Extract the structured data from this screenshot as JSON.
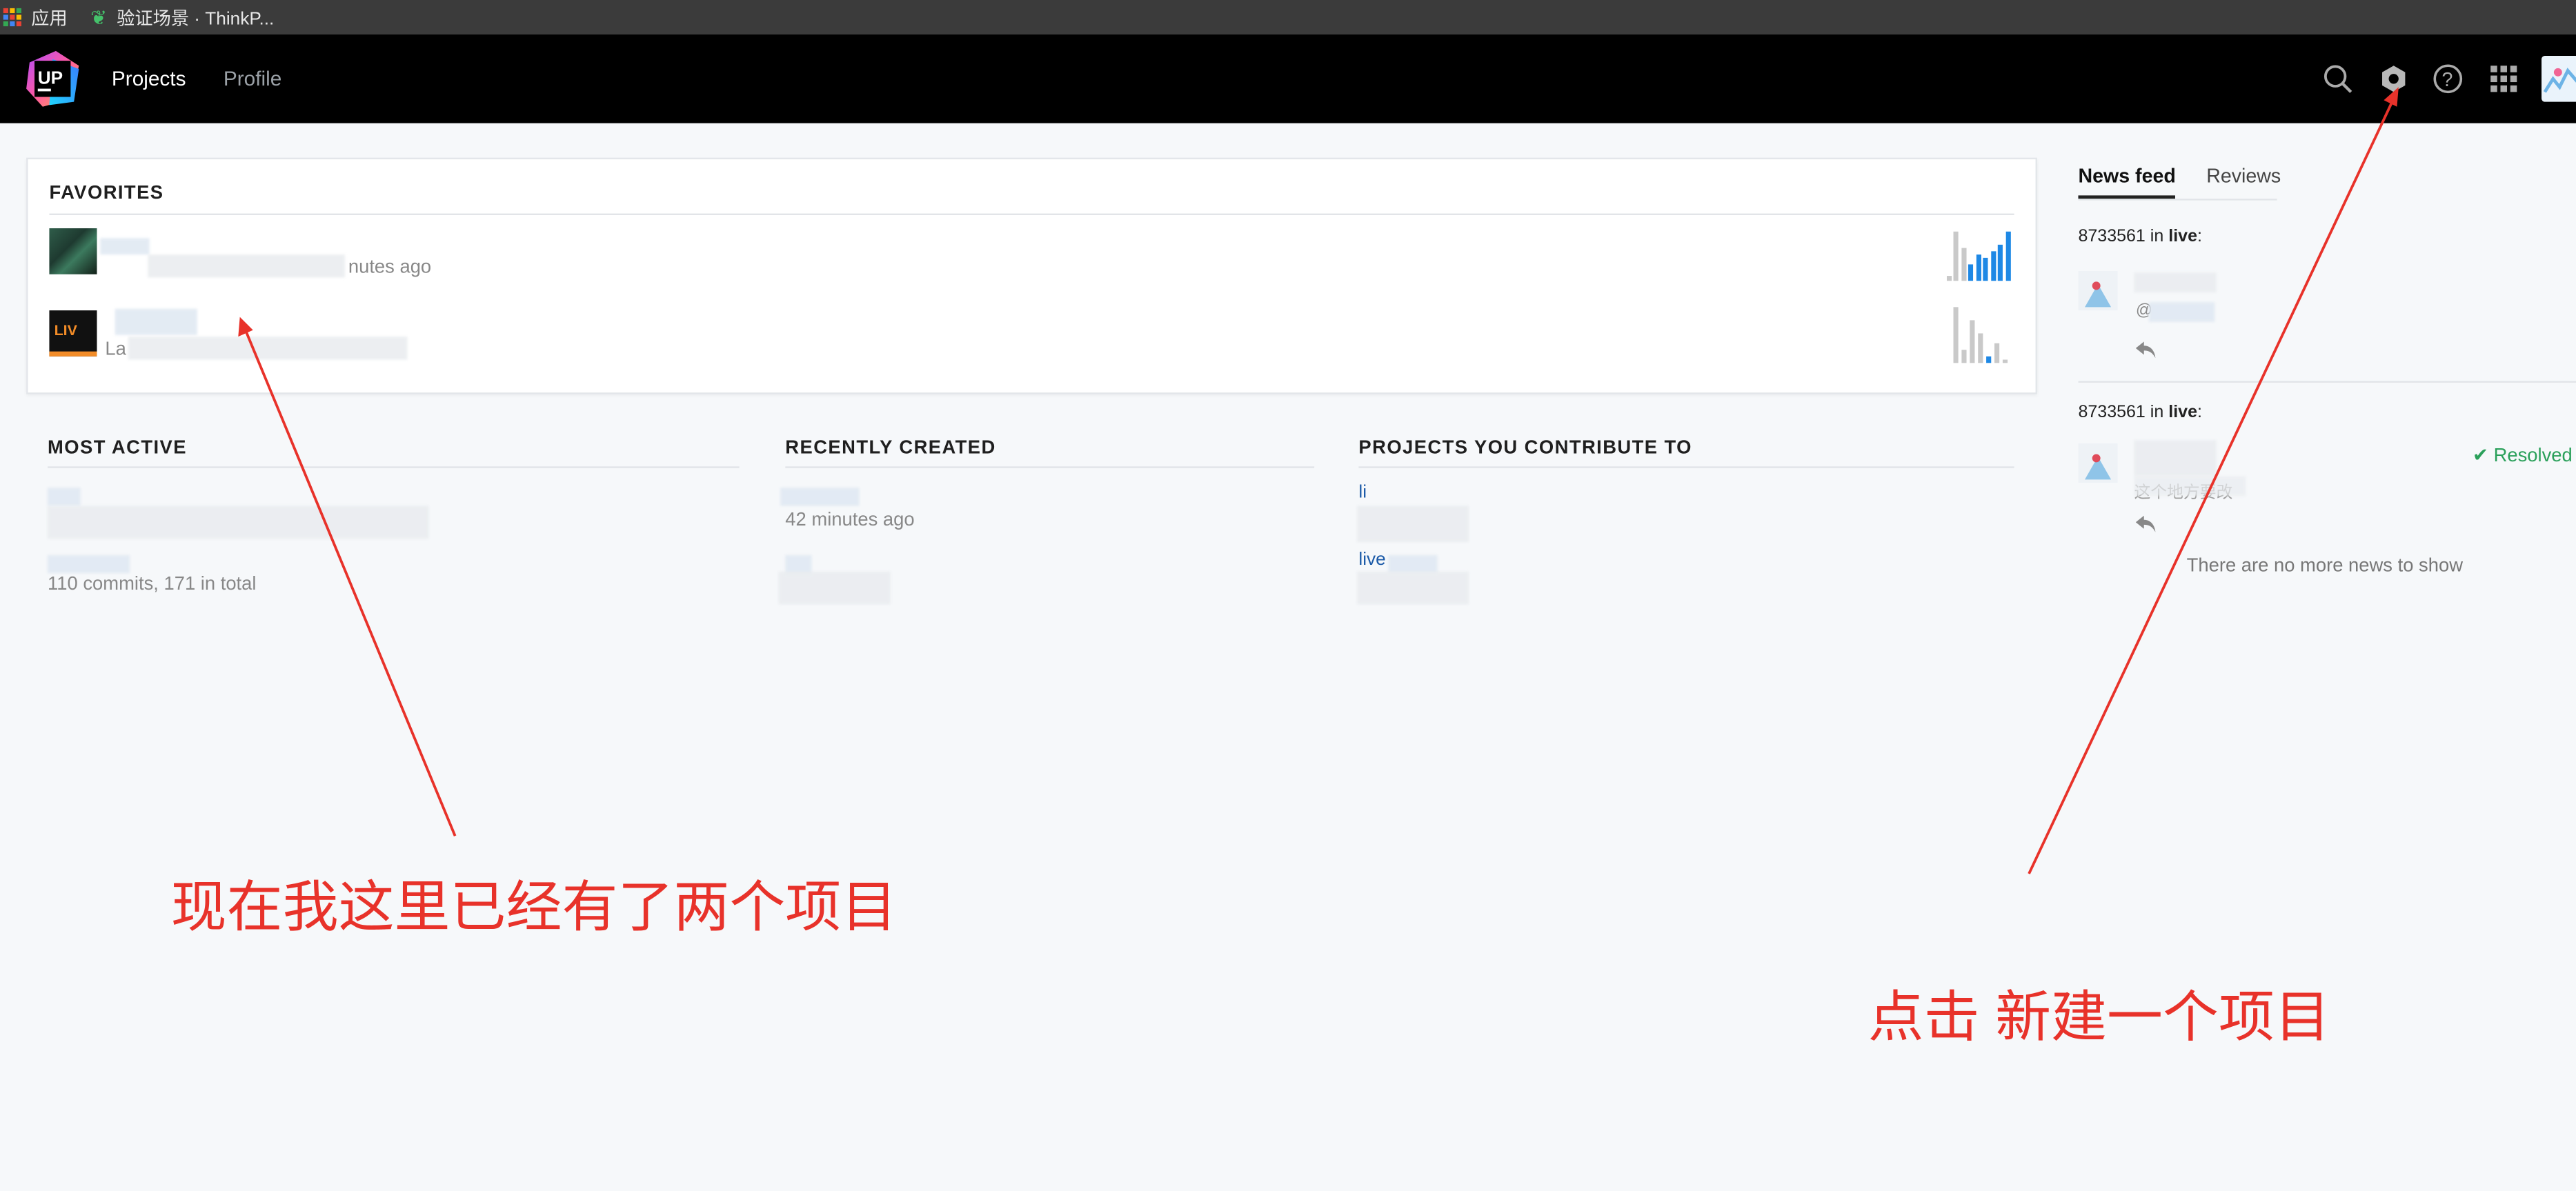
{
  "browser": {
    "bookmarks": [
      {
        "label": "应用",
        "icon": "apps-grid-icon"
      },
      {
        "label": "验证场景 · ThinkP...",
        "icon": "leaf-icon"
      }
    ]
  },
  "header": {
    "logo_text": "UP",
    "nav": {
      "projects": "Projects",
      "profile": "Profile"
    },
    "icons": [
      "search-icon",
      "settings-hexagon-icon",
      "help-icon",
      "apps-grid-icon",
      "avatar"
    ]
  },
  "favorites": {
    "title": "FAVORITES",
    "items": [
      {
        "meta_suffix": "nutes ago"
      },
      {
        "thumb_text": "LIV",
        "meta_prefix": "La"
      }
    ]
  },
  "most_active": {
    "title": "MOST ACTIVE",
    "stats": "110 commits, 171 in total"
  },
  "recently_created": {
    "title": "RECENTLY CREATED",
    "time": "42 minutes ago"
  },
  "contribute": {
    "title": "PROJECTS YOU CONTRIBUTE TO",
    "items": [
      "li",
      "live"
    ]
  },
  "feed": {
    "tabs": {
      "news": "News feed",
      "reviews": "Reviews"
    },
    "entries": [
      {
        "user": "8733561",
        "in": "in",
        "project": "live",
        "mention": "@"
      },
      {
        "user": "8733561",
        "in": "in",
        "project": "live",
        "status": "Resolved",
        "text": "这个地方要改"
      }
    ],
    "no_more": "There are no more news to show"
  },
  "annotations": {
    "left": "现在我这里已经有了两个项目",
    "right": "点击 新建一个项目"
  },
  "colors": {
    "header_bg": "#000000",
    "page_bg": "#f6f8fa",
    "annotation": "#e8322a",
    "resolved": "#2aa05a",
    "link": "#1b5aa8"
  }
}
